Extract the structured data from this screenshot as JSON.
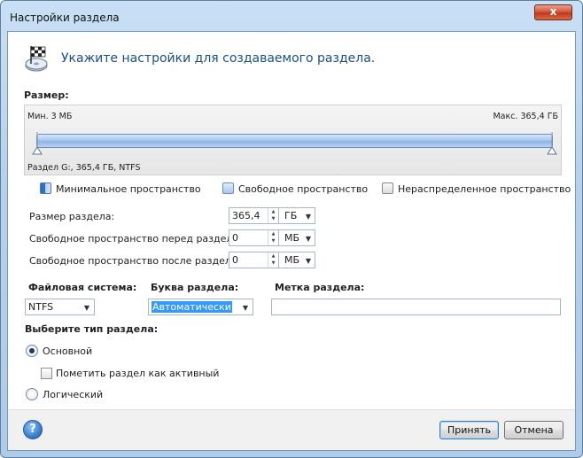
{
  "window": {
    "title": "Настройки раздела",
    "close_glyph": "x",
    "header": "Укажите настройки для создаваемого раздела.",
    "header_icon": "checkered-flag-disk-icon"
  },
  "size_section": {
    "label": "Размер:",
    "min_label": "Мин. 3 МБ",
    "max_label": "Макс. 365,4 ГБ",
    "partition_label": "Раздел G:, 365,4 ГБ, NTFS",
    "slider_fill_fraction": 1.0
  },
  "legend": {
    "min_space": "Минимальное пространство",
    "free_space": "Свободное пространство",
    "unallocated": "Нераспределенное пространство"
  },
  "fields": {
    "partition_size": {
      "label": "Размер раздела:",
      "value": "365,4",
      "unit": "ГБ"
    },
    "free_before": {
      "label": "Свободное пространство перед разделом:",
      "value": "0",
      "unit": "МБ"
    },
    "free_after": {
      "label": "Свободное пространство после раздела:",
      "value": "0",
      "unit": "МБ"
    }
  },
  "filesystem": {
    "label": "Файловая система:",
    "value": "NTFS"
  },
  "drive_letter": {
    "label": "Буква раздела:",
    "value": "Автоматически"
  },
  "volume_label": {
    "label": "Метка раздела:",
    "value": ""
  },
  "partition_type": {
    "label": "Выберите тип раздела:",
    "primary": "Основной",
    "mark_active": "Пометить раздел как активный",
    "logical": "Логический",
    "selected": "primary"
  },
  "footer": {
    "help_glyph": "?",
    "ok": "Принять",
    "cancel": "Отмена"
  },
  "colors": {
    "accent": "#1c4f8a",
    "bar": "#a9c8ef",
    "selection": "#3399ff"
  }
}
